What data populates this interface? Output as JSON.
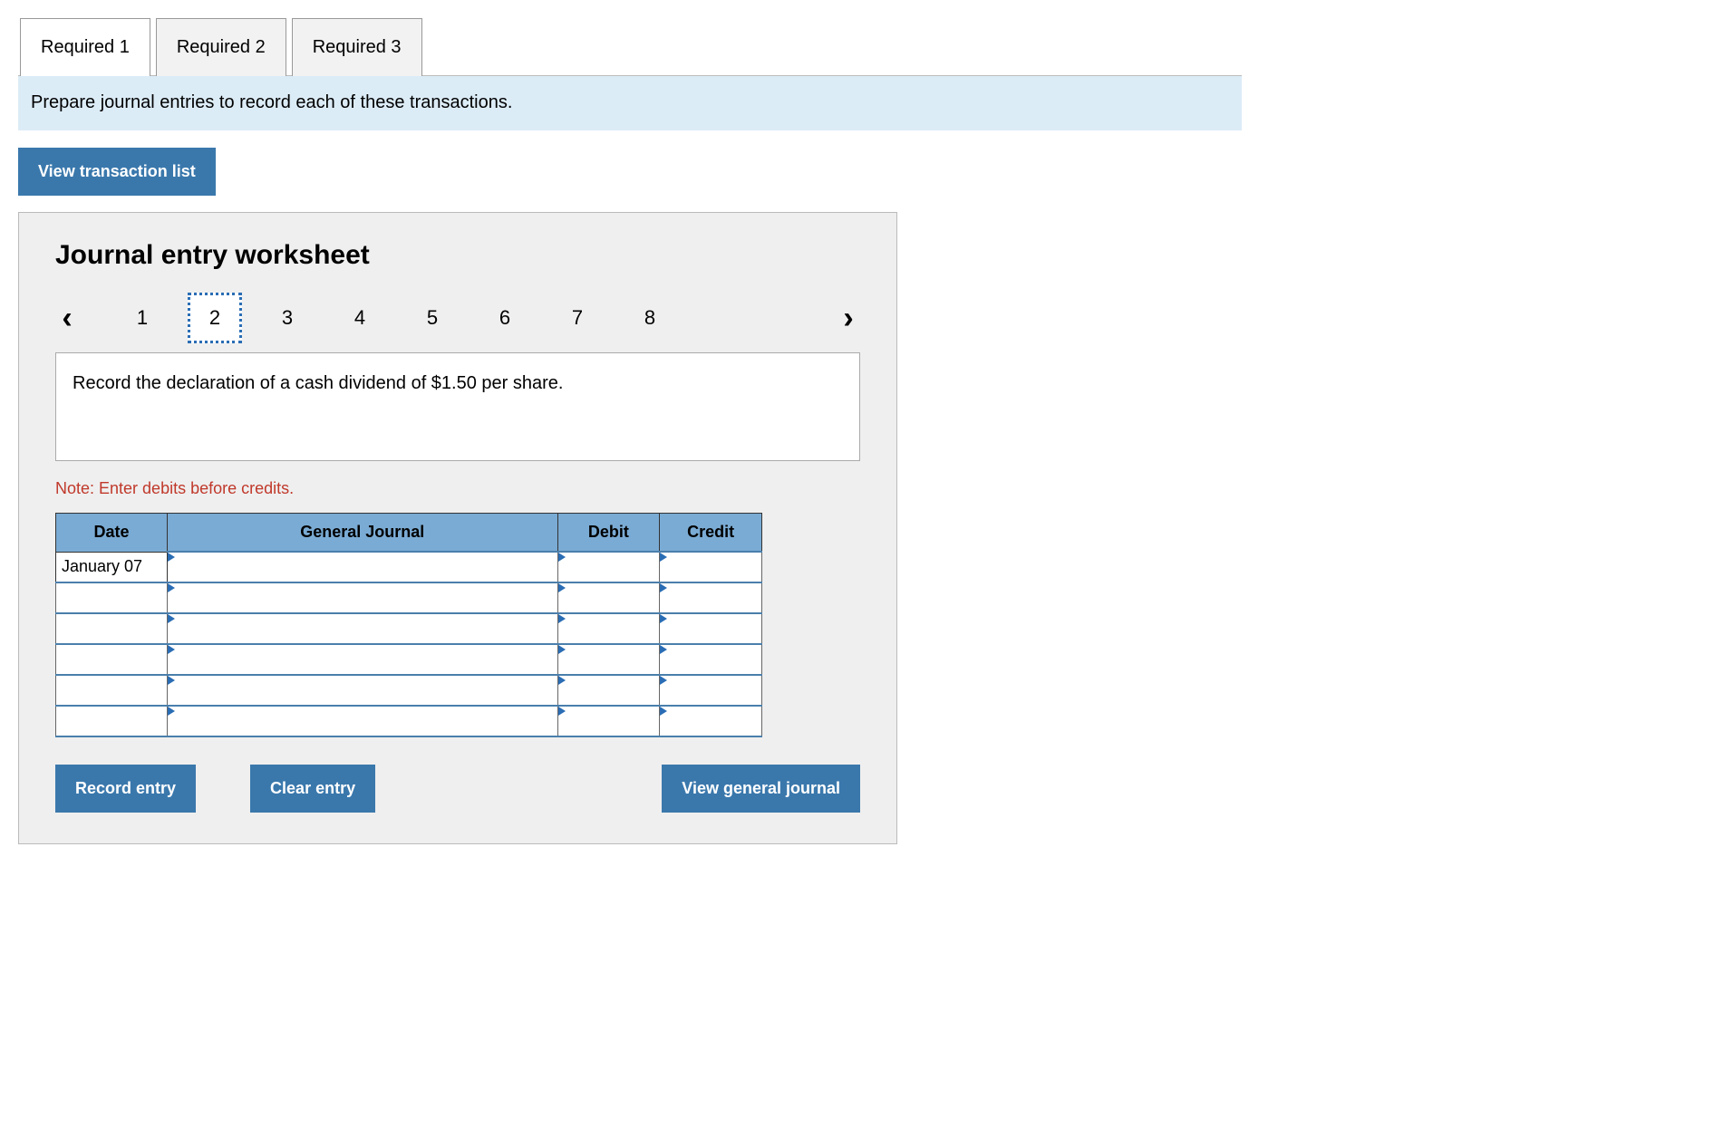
{
  "tabs": [
    {
      "label": "Required 1",
      "active": true
    },
    {
      "label": "Required 2",
      "active": false
    },
    {
      "label": "Required 3",
      "active": false
    }
  ],
  "instruction": "Prepare journal entries to record each of these transactions.",
  "view_trans_button": "View transaction list",
  "worksheet": {
    "title": "Journal entry worksheet",
    "pages": [
      "1",
      "2",
      "3",
      "4",
      "5",
      "6",
      "7",
      "8"
    ],
    "active_page": "2",
    "prompt": "Record the declaration of a cash dividend of $1.50 per share.",
    "note": "Note: Enter debits before credits.",
    "table": {
      "headers": {
        "date": "Date",
        "general_journal": "General Journal",
        "debit": "Debit",
        "credit": "Credit"
      },
      "rows": [
        {
          "date": "January 07",
          "gj": "",
          "debit": "",
          "credit": ""
        },
        {
          "date": "",
          "gj": "",
          "debit": "",
          "credit": ""
        },
        {
          "date": "",
          "gj": "",
          "debit": "",
          "credit": ""
        },
        {
          "date": "",
          "gj": "",
          "debit": "",
          "credit": ""
        },
        {
          "date": "",
          "gj": "",
          "debit": "",
          "credit": ""
        },
        {
          "date": "",
          "gj": "",
          "debit": "",
          "credit": ""
        }
      ]
    },
    "buttons": {
      "record": "Record entry",
      "clear": "Clear entry",
      "view_journal": "View general journal"
    }
  }
}
